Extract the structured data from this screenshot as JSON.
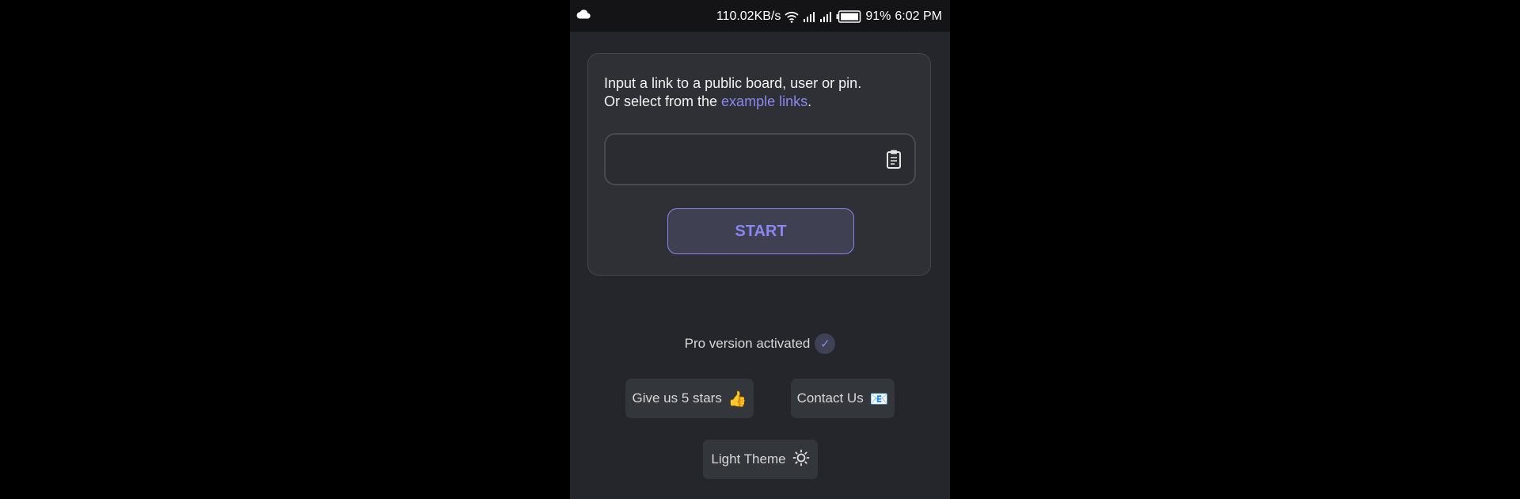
{
  "statusbar": {
    "speed": "110.02KB/s",
    "battery": "91%",
    "time": "6:02 PM"
  },
  "card": {
    "instruction_line1": "Input a link to a public board, user or pin.",
    "instruction_line2_prefix": "Or select from the ",
    "example_link": "example links",
    "instruction_line2_suffix": ".",
    "input_value": "",
    "start_label": "START"
  },
  "footer": {
    "pro_label": "Pro version activated",
    "check_glyph": "✓",
    "rate_label": "Give us 5 stars",
    "rate_emoji": "👍",
    "contact_label": "Contact Us",
    "contact_emoji": "📧",
    "theme_label": "Light Theme"
  },
  "colors": {
    "accent": "#8c84f0",
    "background": "#24262b",
    "card": "#2e3035"
  },
  "icons": {
    "statusbar": [
      "cloud-icon",
      "wifi-icon",
      "signal-icon",
      "battery-icon"
    ],
    "input": "clipboard-icon",
    "theme": "sun-icon"
  }
}
